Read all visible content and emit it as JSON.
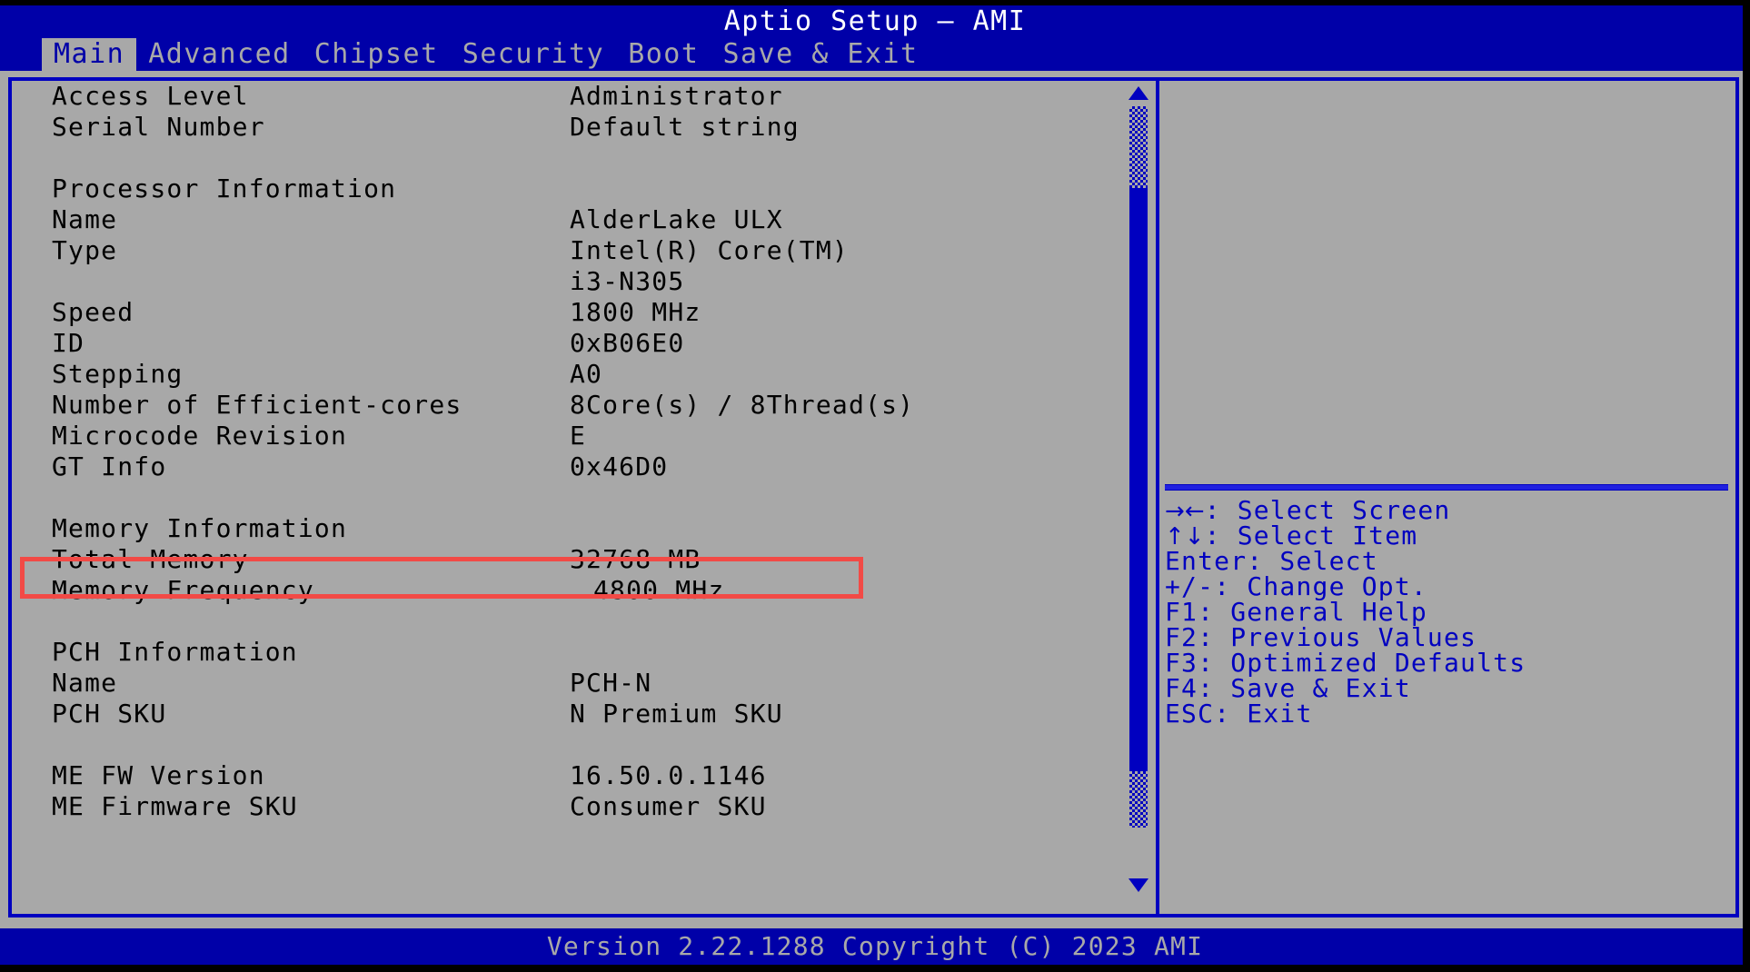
{
  "window": {
    "title": "Aptio Setup – AMI"
  },
  "colors": {
    "title_bar": "#0000a8",
    "panel_bg": "#a8a8a8",
    "frame_border": "#0000c0",
    "help_text": "#0000c0",
    "body_text": "#000000",
    "tab_active_bg": "#a8a8a8",
    "tab_active_text": "#0000a8",
    "tab_inactive_text": "#a8a8a8",
    "annotation": "#f24a46",
    "scrollbar": "#0000c0"
  },
  "tabs": [
    {
      "label": "Main",
      "active": true
    },
    {
      "label": "Advanced",
      "active": false
    },
    {
      "label": "Chipset",
      "active": false
    },
    {
      "label": "Security",
      "active": false
    },
    {
      "label": "Boot",
      "active": false
    },
    {
      "label": "Save & Exit",
      "active": false
    }
  ],
  "main": {
    "rows": [
      {
        "label": "Access Level",
        "value": "Administrator"
      },
      {
        "label": "Serial Number",
        "value": "Default string"
      },
      {
        "label": "",
        "value": ""
      },
      {
        "label": "Processor Information",
        "value": ""
      },
      {
        "label": "Name",
        "value": "AlderLake ULX"
      },
      {
        "label": "Type",
        "value": "Intel(R) Core(TM)"
      },
      {
        "label": "",
        "value": "i3-N305"
      },
      {
        "label": "Speed",
        "value": "1800 MHz"
      },
      {
        "label": "ID",
        "value": "0xB06E0"
      },
      {
        "label": "Stepping",
        "value": "A0"
      },
      {
        "label": "Number of Efficient-cores",
        "value": "8Core(s) / 8Thread(s)"
      },
      {
        "label": "Microcode Revision",
        "value": "E"
      },
      {
        "label": "GT Info",
        "value": "0x46D0"
      },
      {
        "label": "",
        "value": ""
      },
      {
        "label": "Memory Information",
        "value": ""
      },
      {
        "label": "Total Memory",
        "value": "32768 MB",
        "highlighted": true
      },
      {
        "label": "Memory Frequency",
        "value": "4800 MHz",
        "indent_value": true
      },
      {
        "label": "",
        "value": ""
      },
      {
        "label": "PCH Information",
        "value": ""
      },
      {
        "label": "Name",
        "value": "PCH-N"
      },
      {
        "label": "PCH SKU",
        "value": "N Premium SKU"
      },
      {
        "label": "",
        "value": ""
      },
      {
        "label": "ME FW Version",
        "value": "16.50.0.1146"
      },
      {
        "label": "ME Firmware SKU",
        "value": "Consumer SKU"
      }
    ]
  },
  "scrollbar": {
    "up_arrow": "scroll-up-arrow",
    "down_arrow": "scroll-down-arrow",
    "position": "middle"
  },
  "help": {
    "lines": [
      {
        "keys": "→←",
        "text": ": Select Screen",
        "is_arrow": true
      },
      {
        "keys": "↑↓",
        "text": ": Select Item",
        "is_arrow": true
      },
      {
        "keys": "Enter",
        "text": ": Select",
        "is_arrow": false
      },
      {
        "keys": "+/-",
        "text": ": Change Opt.",
        "is_arrow": false
      },
      {
        "keys": "F1",
        "text": ": General Help",
        "is_arrow": false
      },
      {
        "keys": "F2",
        "text": ": Previous Values",
        "is_arrow": false
      },
      {
        "keys": "F3",
        "text": ": Optimized Defaults",
        "is_arrow": false
      },
      {
        "keys": "F4",
        "text": ": Save & Exit",
        "is_arrow": false
      },
      {
        "keys": "ESC",
        "text": ": Exit",
        "is_arrow": false
      }
    ]
  },
  "footer": {
    "text": "Version 2.22.1288 Copyright (C) 2023 AMI"
  }
}
